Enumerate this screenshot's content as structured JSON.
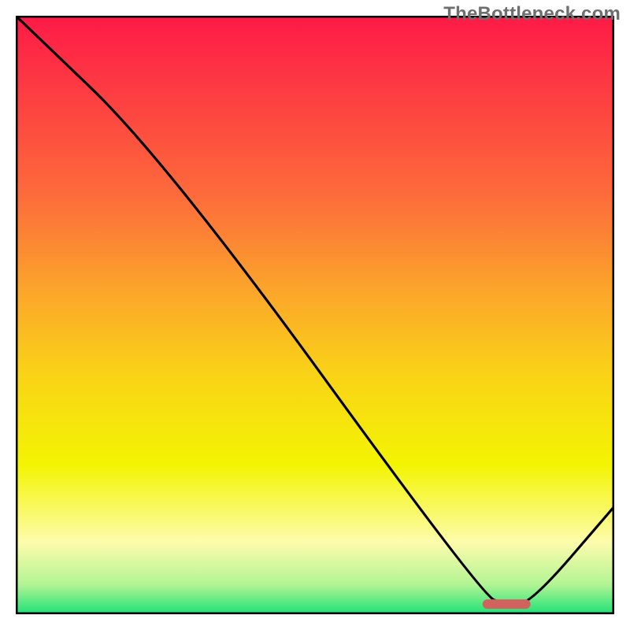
{
  "watermark": "TheBottleneck.com",
  "chart_data": {
    "type": "line",
    "title": "",
    "xlabel": "",
    "ylabel": "",
    "xlim": [
      0,
      100
    ],
    "ylim": [
      0,
      100
    ],
    "grid": false,
    "legend": false,
    "series": [
      {
        "name": "curve",
        "x": [
          0,
          25,
          78,
          82,
          86,
          100
        ],
        "values": [
          100,
          76,
          3,
          1.7,
          1.7,
          18
        ]
      }
    ],
    "marker": {
      "name": "optimal-range",
      "x_start": 78,
      "x_end": 86,
      "y": 1.7,
      "color": "#d1625d"
    },
    "background_gradient": {
      "stops": [
        {
          "y": 100,
          "color": "#fd1a47"
        },
        {
          "y": 70,
          "color": "#fd6b3b"
        },
        {
          "y": 55,
          "color": "#fca22c"
        },
        {
          "y": 40,
          "color": "#f9d317"
        },
        {
          "y": 25,
          "color": "#f3f402"
        },
        {
          "y": 12,
          "color": "#fdfcac"
        },
        {
          "y": 5,
          "color": "#b3f494"
        },
        {
          "y": 0,
          "color": "#1ce277"
        }
      ]
    },
    "colors": {
      "curve": "#000000",
      "frame": "#000000"
    }
  }
}
